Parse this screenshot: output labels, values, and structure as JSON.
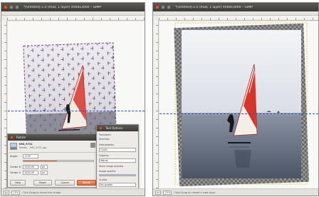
{
  "left_window": {
    "title": "*[Untitled]-1.0 (RGB, 1 layer) 4000x3000 – GIMP",
    "status": {
      "unit": "px",
      "zoom": "25%",
      "message": "Click-Drag to move the image"
    },
    "transform_dialog": {
      "title": "Rotate",
      "layer_name": "IMG_9731",
      "layer_sub": "Rotate – IMG_9731.jpg",
      "angle_label": "Angle:",
      "angle_value": "-2.00",
      "center_x_label": "Center X:",
      "center_x_value": "1500.00",
      "center_y_label": "Center Y:",
      "center_y_value": "1000.00",
      "unit": "px",
      "buttons": [
        "Help",
        "Reset",
        "Cancel",
        "Rotate"
      ]
    },
    "tool_options": {
      "title": "Tool Options",
      "rows": [
        "Transform:",
        "Direction",
        "Interpolation",
        "Cubic",
        "Clipping",
        "Adjust",
        "Show image preview",
        "Image opacity",
        "Guides",
        "No guides"
      ]
    }
  },
  "right_window": {
    "title": "*[Untitled]-2.0 (RGB, 1 layer) 4000x3000 – GIMP",
    "status": {
      "unit": "px",
      "zoom": "25%",
      "message": "Click-Drag to create a new layer"
    }
  },
  "colors": {
    "titlebar": "#3c3b37",
    "close_button": "#e2572b",
    "guide": "#2b4fb0",
    "accent": "#e06a3a",
    "sail": "#d8352a"
  }
}
